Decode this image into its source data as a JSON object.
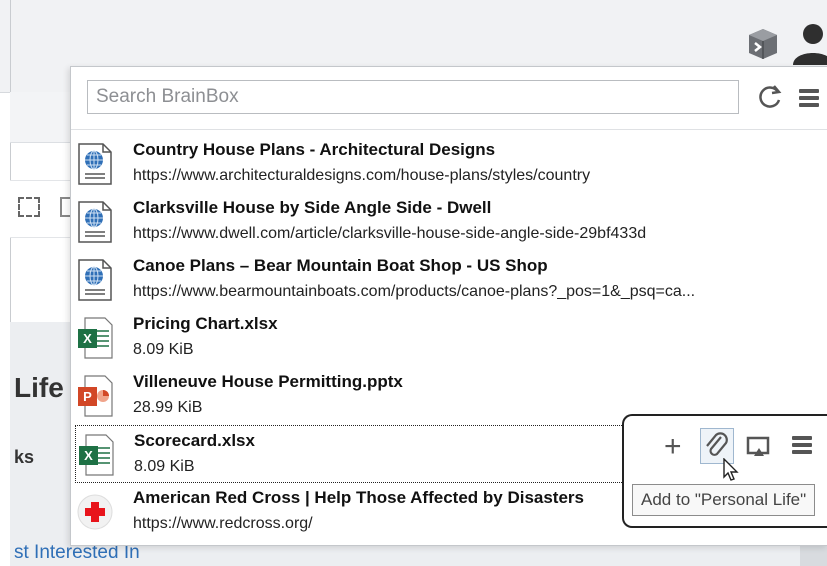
{
  "search": {
    "placeholder": "Search BrainBox"
  },
  "items": [
    {
      "title": "Country House Plans - Architectural Designs",
      "subtitle": "https://www.architecturaldesigns.com/house-plans/styles/country",
      "icon": "web-page-icon"
    },
    {
      "title": "Clarksville House by Side Angle Side - Dwell",
      "subtitle": "https://www.dwell.com/article/clarksville-house-side-angle-side-29bf433d",
      "icon": "web-page-icon"
    },
    {
      "title": "Canoe Plans – Bear Mountain Boat Shop - US Shop",
      "subtitle": "https://www.bearmountainboats.com/products/canoe-plans?_pos=1&_psq=ca...",
      "icon": "web-page-icon"
    },
    {
      "title": "Pricing Chart.xlsx",
      "subtitle": "8.09 KiB",
      "icon": "excel-file-icon"
    },
    {
      "title": "Villeneuve House Permitting.pptx",
      "subtitle": "28.99 KiB",
      "icon": "powerpoint-file-icon"
    },
    {
      "title": "Scorecard.xlsx",
      "subtitle": "8.09 KiB",
      "icon": "excel-file-icon"
    },
    {
      "title": "American Red Cross | Help Those Affected by Disasters",
      "subtitle": "https://www.redcross.org/",
      "icon": "red-cross-icon"
    }
  ],
  "hover_toolbar": {
    "add_label": "+",
    "tooltip": "Add to \"Personal Life\""
  },
  "background": {
    "life_text": "Life",
    "ks_text": "ks",
    "interested_text": "st Interested In"
  },
  "colors": {
    "excel_green": "#1e7145",
    "powerpoint_red": "#d24726",
    "link_blue": "#2f6fb7",
    "red_cross": "#e8141b"
  }
}
